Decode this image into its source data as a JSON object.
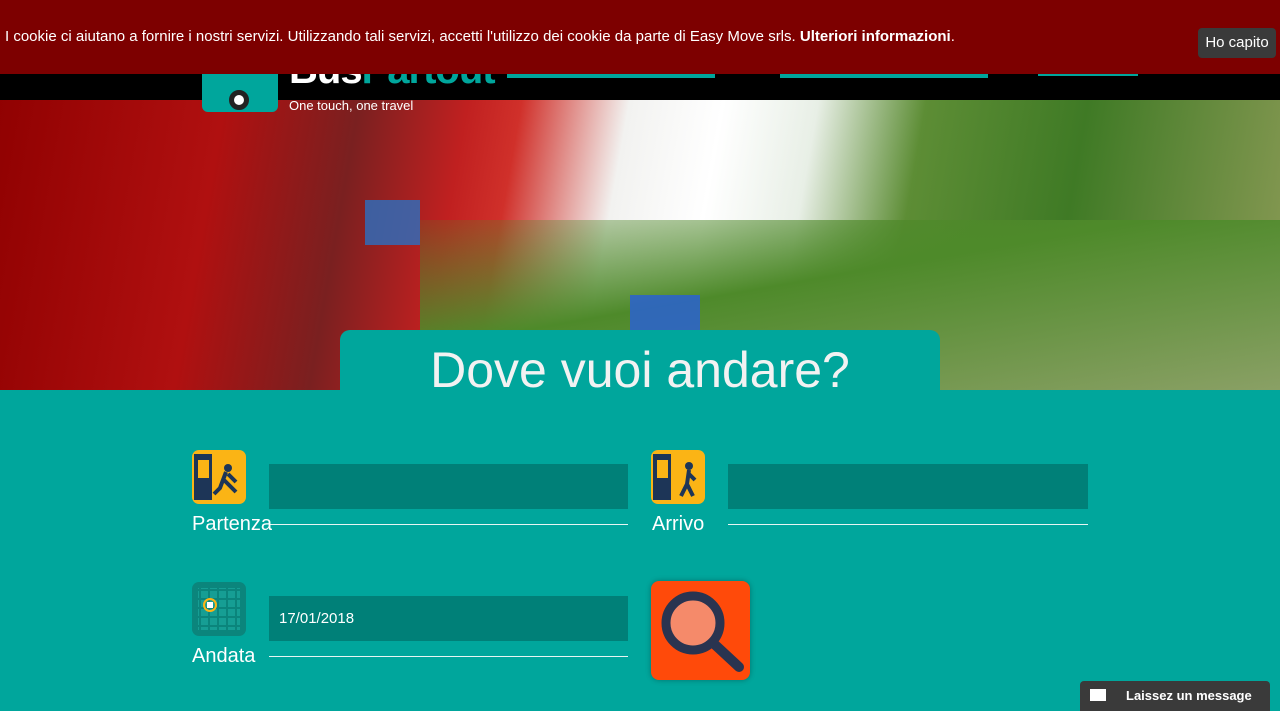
{
  "cookie_banner": {
    "message": "I cookie ci aiutano a fornire i nostri servizi. Utilizzando tali servizi, accetti l'utilizzo dei cookie da parte di Easy Move srls.",
    "more_link": "Ulteriori informazioni",
    "ok_button": "Ho capito"
  },
  "header": {
    "logo_part1": "Bus",
    "logo_part2": "Partout",
    "tagline": "One touch, one travel"
  },
  "hero": {
    "title": "Dove vuoi andare?"
  },
  "form": {
    "departure": {
      "label": "Partenza",
      "value": "",
      "icon": "bus-departure-icon"
    },
    "arrival": {
      "label": "Arrivo",
      "value": "",
      "icon": "bus-arrival-icon"
    },
    "date": {
      "label": "Andata",
      "value": "17/01/2018",
      "icon": "calendar-icon"
    },
    "search_icon": "magnifier-icon"
  },
  "chat": {
    "label": "Laissez un message"
  },
  "colors": {
    "brand": "#00a69c",
    "cookie_bg": "#7d0000",
    "search": "#ff4a0a",
    "field": "#008078"
  }
}
